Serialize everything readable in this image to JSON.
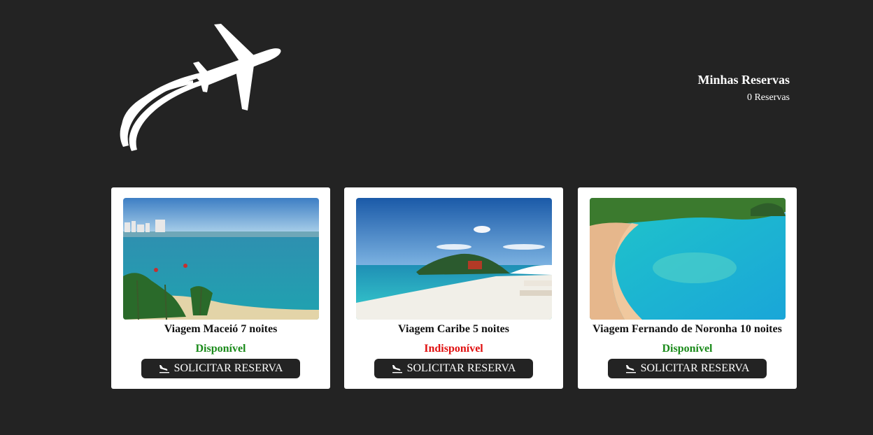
{
  "header": {
    "reservas_title": "Minhas Reservas",
    "reservas_count": "0 Reservas"
  },
  "colors": {
    "background": "#232323",
    "available": "#1a8a1a",
    "unavailable": "#e01010"
  },
  "trips": [
    {
      "name": "Viagem Maceió 7 noites",
      "status": "Disponível",
      "button_label": "SOLICITAR RESERVA"
    },
    {
      "name": "Viagem Caribe 5 noites",
      "status": "Indisponível",
      "button_label": "SOLICITAR RESERVA"
    },
    {
      "name": "Viagem Fernando de Noronha 10 noites",
      "status": "Disponível",
      "button_label": "SOLICITAR RESERVA"
    }
  ]
}
